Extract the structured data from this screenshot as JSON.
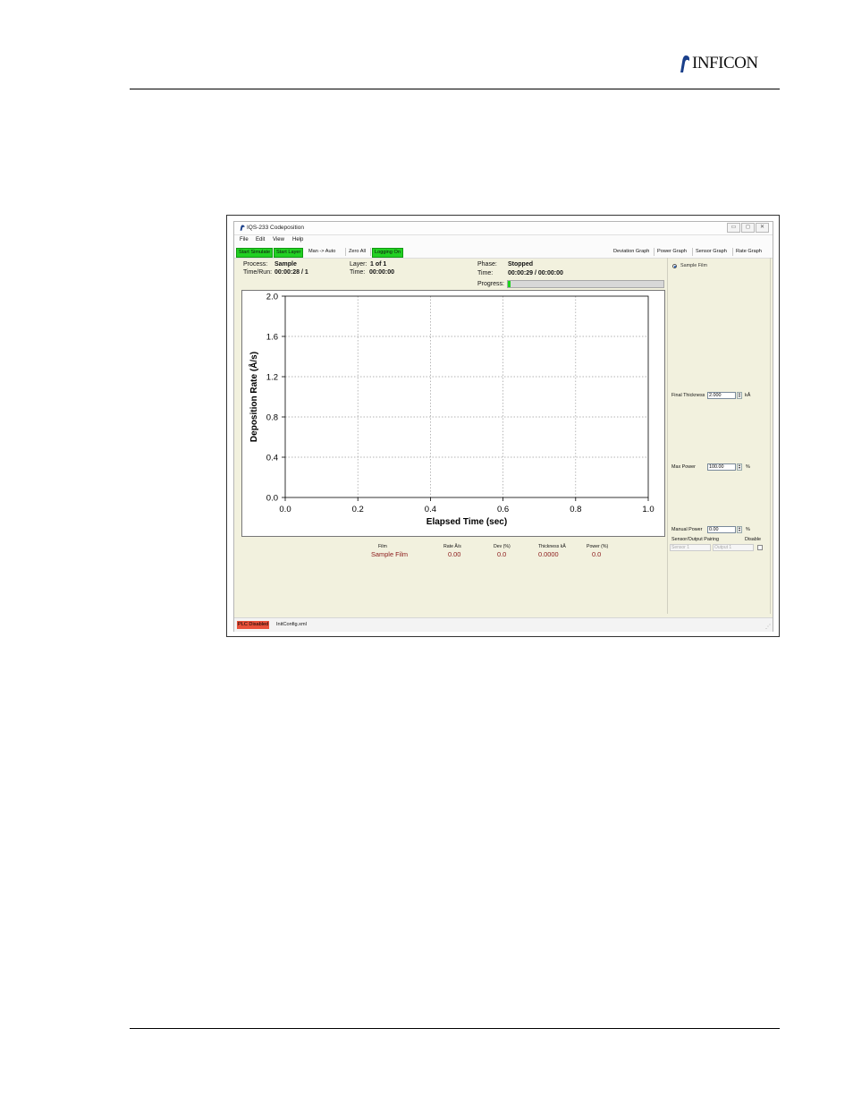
{
  "page": {
    "logo_text": "INFICON"
  },
  "app": {
    "title": "IQS-233 Codeposition",
    "window_buttons": {
      "minimize": "▭",
      "maximize": "◻",
      "close": "✕"
    },
    "menu": [
      "File",
      "Edit",
      "View",
      "Help"
    ],
    "toolbar_left": [
      {
        "label": "Start Simulate",
        "highlight": true
      },
      {
        "label": "Start Layer",
        "highlight": true
      },
      {
        "label": "Man -> Auto",
        "highlight": false
      },
      {
        "label": "Zero All",
        "highlight": false
      },
      {
        "label": "Logging On",
        "highlight": true
      }
    ],
    "toolbar_right": [
      "Deviation Graph",
      "Power Graph",
      "Sensor Graph",
      "Rate Graph"
    ],
    "info": {
      "process_label": "Process:",
      "process_value": "Sample",
      "timerun_label": "Time/Run:",
      "timerun_value": "00:00:28 / 1",
      "layer_label": "Layer:",
      "layer_value": "1 of 1",
      "time_label": "Time:",
      "time_value": "00:00:00",
      "phase_label": "Phase:",
      "phase_value": "Stopped",
      "phase_time_label": "Time:",
      "phase_time_value": "00:00:29 / 00:00:00",
      "progress_label": "Progress:",
      "progress_fraction": 0.02
    },
    "right_panel": {
      "film_radio_label": "Sample Film",
      "final_thickness_label": "Final Thickness",
      "final_thickness_value": "2.000",
      "final_thickness_unit": "kÅ",
      "max_power_label": "Max Power",
      "max_power_value": "100.00",
      "max_power_unit": "%",
      "manual_power_label": "Manual Power",
      "manual_power_value": "0.00",
      "manual_power_unit": "%",
      "pairing_label": "Sensor/Output Pairing",
      "disable_label": "Disable",
      "sensor_value": "Sensor 1",
      "output_value": "Output 1"
    },
    "film_table": {
      "headers": [
        "Film",
        "Rate Å/s",
        "Dev (%)",
        "Thickness kÅ",
        "Power (%)"
      ],
      "values": [
        "Sample Film",
        "0.00",
        "0.0",
        "0.0000",
        "0.0"
      ]
    },
    "status": {
      "plc": "PLC Disabled",
      "file": "InitConfig.xml"
    },
    "colors": {
      "green_button": "#22d022",
      "plc_red": "#e8503a",
      "film_value": "#8b1a1a",
      "panel_bg": "#f2f1de"
    }
  },
  "chart_data": {
    "type": "line",
    "series": [],
    "xlabel": "Elapsed Time (sec)",
    "ylabel": "Deposition Rate (Å/s)",
    "xlim": [
      0.0,
      1.0
    ],
    "ylim": [
      0.0,
      2.0
    ],
    "x_ticks": [
      "0.0",
      "0.2",
      "0.4",
      "0.6",
      "0.8",
      "1.0"
    ],
    "y_ticks": [
      "0.0",
      "0.4",
      "0.8",
      "1.2",
      "1.6",
      "2.0"
    ],
    "grid": true
  }
}
